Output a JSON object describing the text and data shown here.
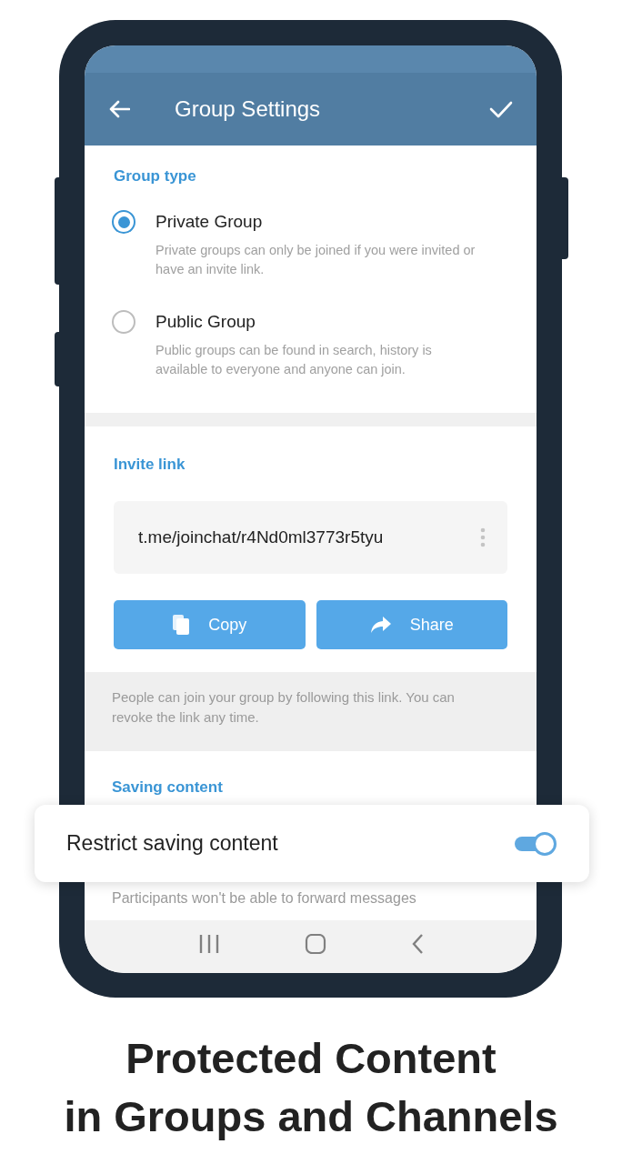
{
  "header": {
    "title": "Group Settings"
  },
  "group_type": {
    "label": "Group type",
    "options": [
      {
        "title": "Private Group",
        "description": "Private groups can only be joined if you were invited or have an invite link.",
        "selected": true
      },
      {
        "title": "Public Group",
        "description": "Public groups can be found in search, history is available to everyone and anyone can join.",
        "selected": false
      }
    ]
  },
  "invite": {
    "label": "Invite link",
    "link": "t.me/joinchat/r4Nd0ml3773r5tyu",
    "buttons": [
      {
        "kind": "copy",
        "label": "Copy"
      },
      {
        "kind": "share",
        "label": "Share"
      }
    ],
    "note": "People can join your group by following this link. You can revoke the link any time."
  },
  "saving": {
    "label": "Saving content",
    "toggle": {
      "label": "Restrict saving content",
      "on": true
    },
    "description": "Participants won't be able to forward messages"
  },
  "headline": "Protected Content\nin Groups and Channels"
}
